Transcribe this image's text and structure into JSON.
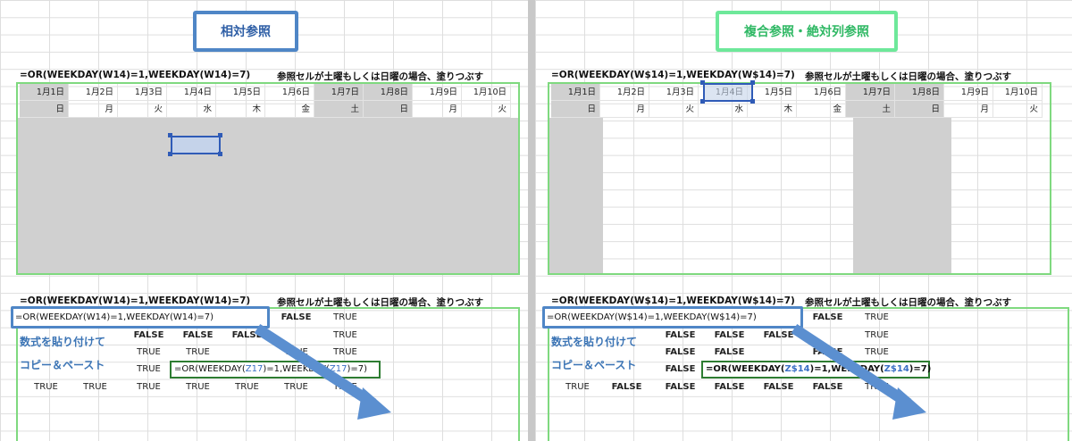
{
  "left": {
    "title": "相対参照",
    "formula_top": "=OR(WEEKDAY(W14)=1,WEEKDAY(W14)=7)",
    "note_top": "参照セルが土曜もしくは日曜の場合、塗りつぶす",
    "formula_bottom": "=OR(WEEKDAY(W14)=1,WEEKDAY(W14)=7)",
    "note_bottom": "参照セルが土曜もしくは日曜の場合、塗りつぶす",
    "boxed_formula": "=OR(WEEKDAY(W14)=1,WEEKDAY(W14)=7)",
    "edit_formula_prefix": "=OR(WEEKDAY(",
    "edit_ref1": "Z17",
    "edit_formula_mid": ")=1,WEEKDAY(",
    "edit_ref2": "Z17",
    "edit_formula_suffix": ")=7)",
    "caption1": "数式を貼り付けて",
    "caption2": "コピー＆ペースト",
    "row1": [
      "FALSE",
      "TRUE"
    ],
    "row2": [
      "FALSE",
      "FALSE",
      "FALSE",
      "TRUE"
    ],
    "row3": [
      "TRUE",
      "TRUE",
      "TRUE",
      "TRUE"
    ],
    "row4_first": "TRUE",
    "row5": [
      "TRUE",
      "TRUE",
      "TRUE",
      "TRUE",
      "TRUE",
      "TRUE",
      "TRUE"
    ]
  },
  "right": {
    "title": "複合参照・絶対列参照",
    "formula_top": "=OR(WEEKDAY(W$14)=1,WEEKDAY(W$14)=7)",
    "note_top": "参照セルが土曜もしくは日曜の場合、塗りつぶす",
    "formula_bottom": "=OR(WEEKDAY(W$14)=1,WEEKDAY(W$14)=7)",
    "note_bottom": "参照セルが土曜もしくは日曜の場合、塗りつぶす",
    "boxed_formula": "=OR(WEEKDAY(W$14)=1,WEEKDAY(W$14)=7)",
    "edit_formula_prefix": "=OR(WEEKDAY(",
    "edit_ref1": "Z$14",
    "edit_formula_mid": ")=1,WEEKDAY(",
    "edit_ref2": "Z$14",
    "edit_formula_suffix": ")=7)",
    "caption1": "数式を貼り付けて",
    "caption2": "コピー＆ペースト",
    "row1": [
      "FALSE",
      "TRUE"
    ],
    "row2": [
      "FALSE",
      "FALSE",
      "FALSE",
      "TRUE"
    ],
    "row3": [
      "FALSE",
      "FALSE",
      "FALSE",
      "TRUE"
    ],
    "row4_first": "FALSE",
    "row5": [
      "TRUE",
      "FALSE",
      "FALSE",
      "FALSE",
      "FALSE",
      "FALSE",
      "TRUE"
    ]
  },
  "dates": [
    "1月1日",
    "1月2日",
    "1月3日",
    "1月4日",
    "1月5日",
    "1月6日",
    "1月7日",
    "1月8日",
    "1月9日",
    "1月10日"
  ],
  "weekdays": [
    "日",
    "月",
    "火",
    "水",
    "木",
    "金",
    "土",
    "日",
    "月",
    "火"
  ],
  "colors": {
    "left_title_border": "#4f86c6",
    "right_title_border": "#6ee89a",
    "frame": "#7fd97f",
    "fill": "#d0d0d0",
    "arrow": "#5b8fd0"
  }
}
